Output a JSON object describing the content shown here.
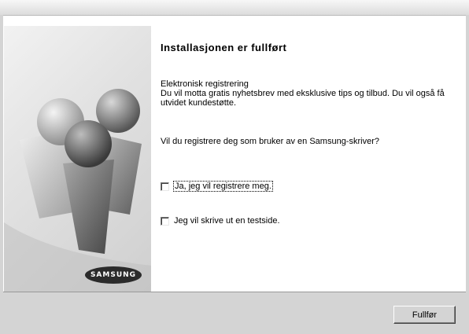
{
  "window": {
    "title": ""
  },
  "sidebar": {
    "logo_text": "SAMSUNG",
    "illustration": "people-figures-graphic"
  },
  "main": {
    "title": "Installasjonen er fullført",
    "registration_heading": "Elektronisk registrering",
    "registration_body": "Du vil motta gratis nyhetsbrev med eksklusive tips og tilbud. Du vil også få utvidet kundestøtte.",
    "question": "Vil du registrere deg som bruker av en Samsung-skriver?",
    "checkboxes": [
      {
        "label": "Ja, jeg vil registrere meg.",
        "checked": false,
        "focused": true
      },
      {
        "label": "Jeg vil skrive ut en testside.",
        "checked": false,
        "focused": false
      }
    ]
  },
  "footer": {
    "finish_label": "Fullfør"
  }
}
